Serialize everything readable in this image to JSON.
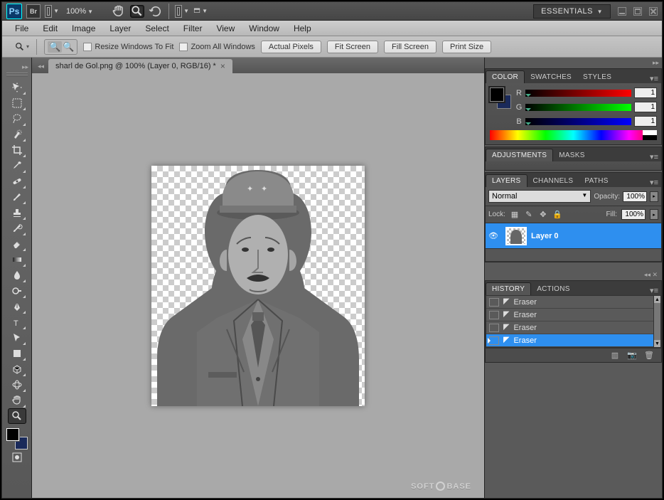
{
  "appbar": {
    "zoom": "100%",
    "workspace": "ESSENTIALS"
  },
  "menu": {
    "file": "File",
    "edit": "Edit",
    "image": "Image",
    "layer": "Layer",
    "select": "Select",
    "filter": "Filter",
    "view": "View",
    "window": "Window",
    "help": "Help"
  },
  "options": {
    "resize": "Resize Windows To Fit",
    "zoomall": "Zoom All Windows",
    "actual": "Actual Pixels",
    "fit": "Fit Screen",
    "fill": "Fill Screen",
    "print": "Print Size"
  },
  "doc": {
    "tab": "sharl de Gol.png @ 100% (Layer 0, RGB/16) *"
  },
  "color": {
    "tab_color": "COLOR",
    "tab_swatches": "SWATCHES",
    "tab_styles": "STYLES",
    "r": "R",
    "g": "G",
    "b": "B",
    "r_val": "1",
    "g_val": "1",
    "b_val": "1"
  },
  "adjustments": {
    "tab_adj": "ADJUSTMENTS",
    "tab_masks": "MASKS"
  },
  "layers": {
    "tab_layers": "LAYERS",
    "tab_channels": "CHANNELS",
    "tab_paths": "PATHS",
    "mode": "Normal",
    "opacity_lbl": "Opacity:",
    "opacity": "100%",
    "lock_lbl": "Lock:",
    "fill_lbl": "Fill:",
    "fill": "100%",
    "layer0": "Layer 0"
  },
  "history": {
    "tab_history": "HISTORY",
    "tab_actions": "ACTIONS",
    "items": [
      "Eraser",
      "Eraser",
      "Eraser",
      "Eraser"
    ]
  },
  "watermark": {
    "a": "SOFT",
    "b": "BASE"
  }
}
